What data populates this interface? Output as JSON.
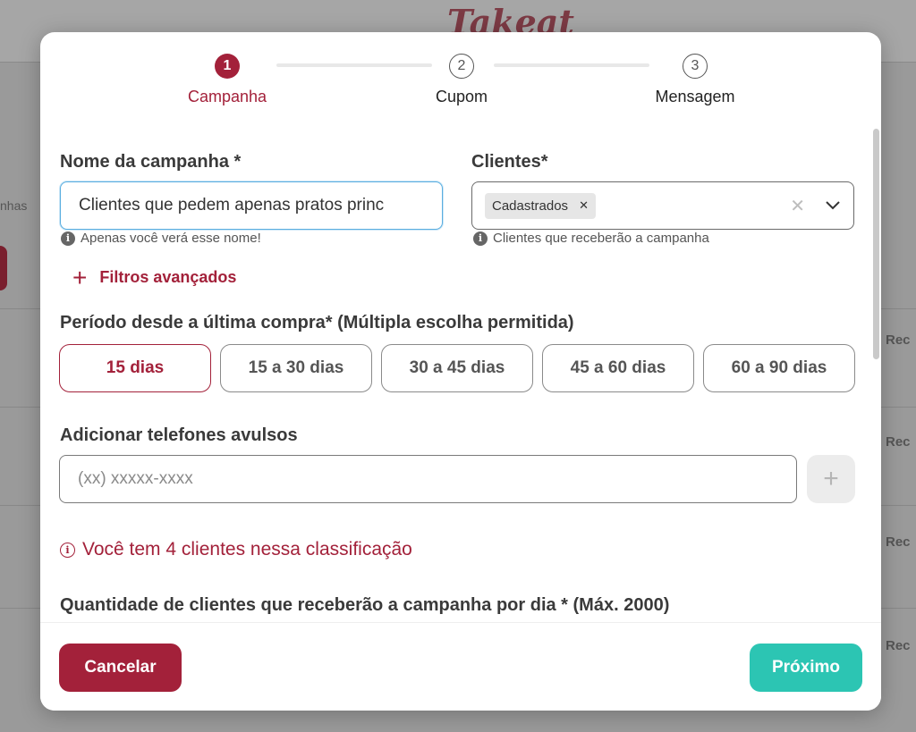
{
  "background": {
    "logo": "Takeat",
    "side_text": "nhas",
    "right_text": "Rec"
  },
  "stepper": {
    "steps": [
      {
        "number": "1",
        "label": "Campanha",
        "active": true
      },
      {
        "number": "2",
        "label": "Cupom",
        "active": false
      },
      {
        "number": "3",
        "label": "Mensagem",
        "active": false
      }
    ]
  },
  "form": {
    "campaign_name": {
      "label": "Nome da campanha *",
      "value": "Clientes que pedem apenas pratos princ",
      "hint": "Apenas você verá esse nome!"
    },
    "clients": {
      "label": "Clientes*",
      "chip": "Cadastrados",
      "hint": "Clientes que receberão a campanha"
    },
    "advanced_filters": "Filtros avançados",
    "period": {
      "label": "Período desde a última compra* (Múltipla escolha permitida)",
      "options": [
        "15 dias",
        "15 a 30 dias",
        "30 a 45 dias",
        "45 a 60 dias",
        "60 a 90 dias"
      ],
      "selected": "15 dias"
    },
    "phones": {
      "label": "Adicionar telefones avulsos",
      "placeholder": "(xx) xxxxx-xxxx"
    },
    "notice": "Você tem 4 clientes nessa classificação",
    "next_label_partial": "Quantidade de clientes que receberão a campanha por dia * (Máx. 2000)"
  },
  "footer": {
    "cancel": "Cancelar",
    "next": "Próximo"
  },
  "colors": {
    "primary": "#a3213a",
    "teal": "#2cc5b3"
  }
}
